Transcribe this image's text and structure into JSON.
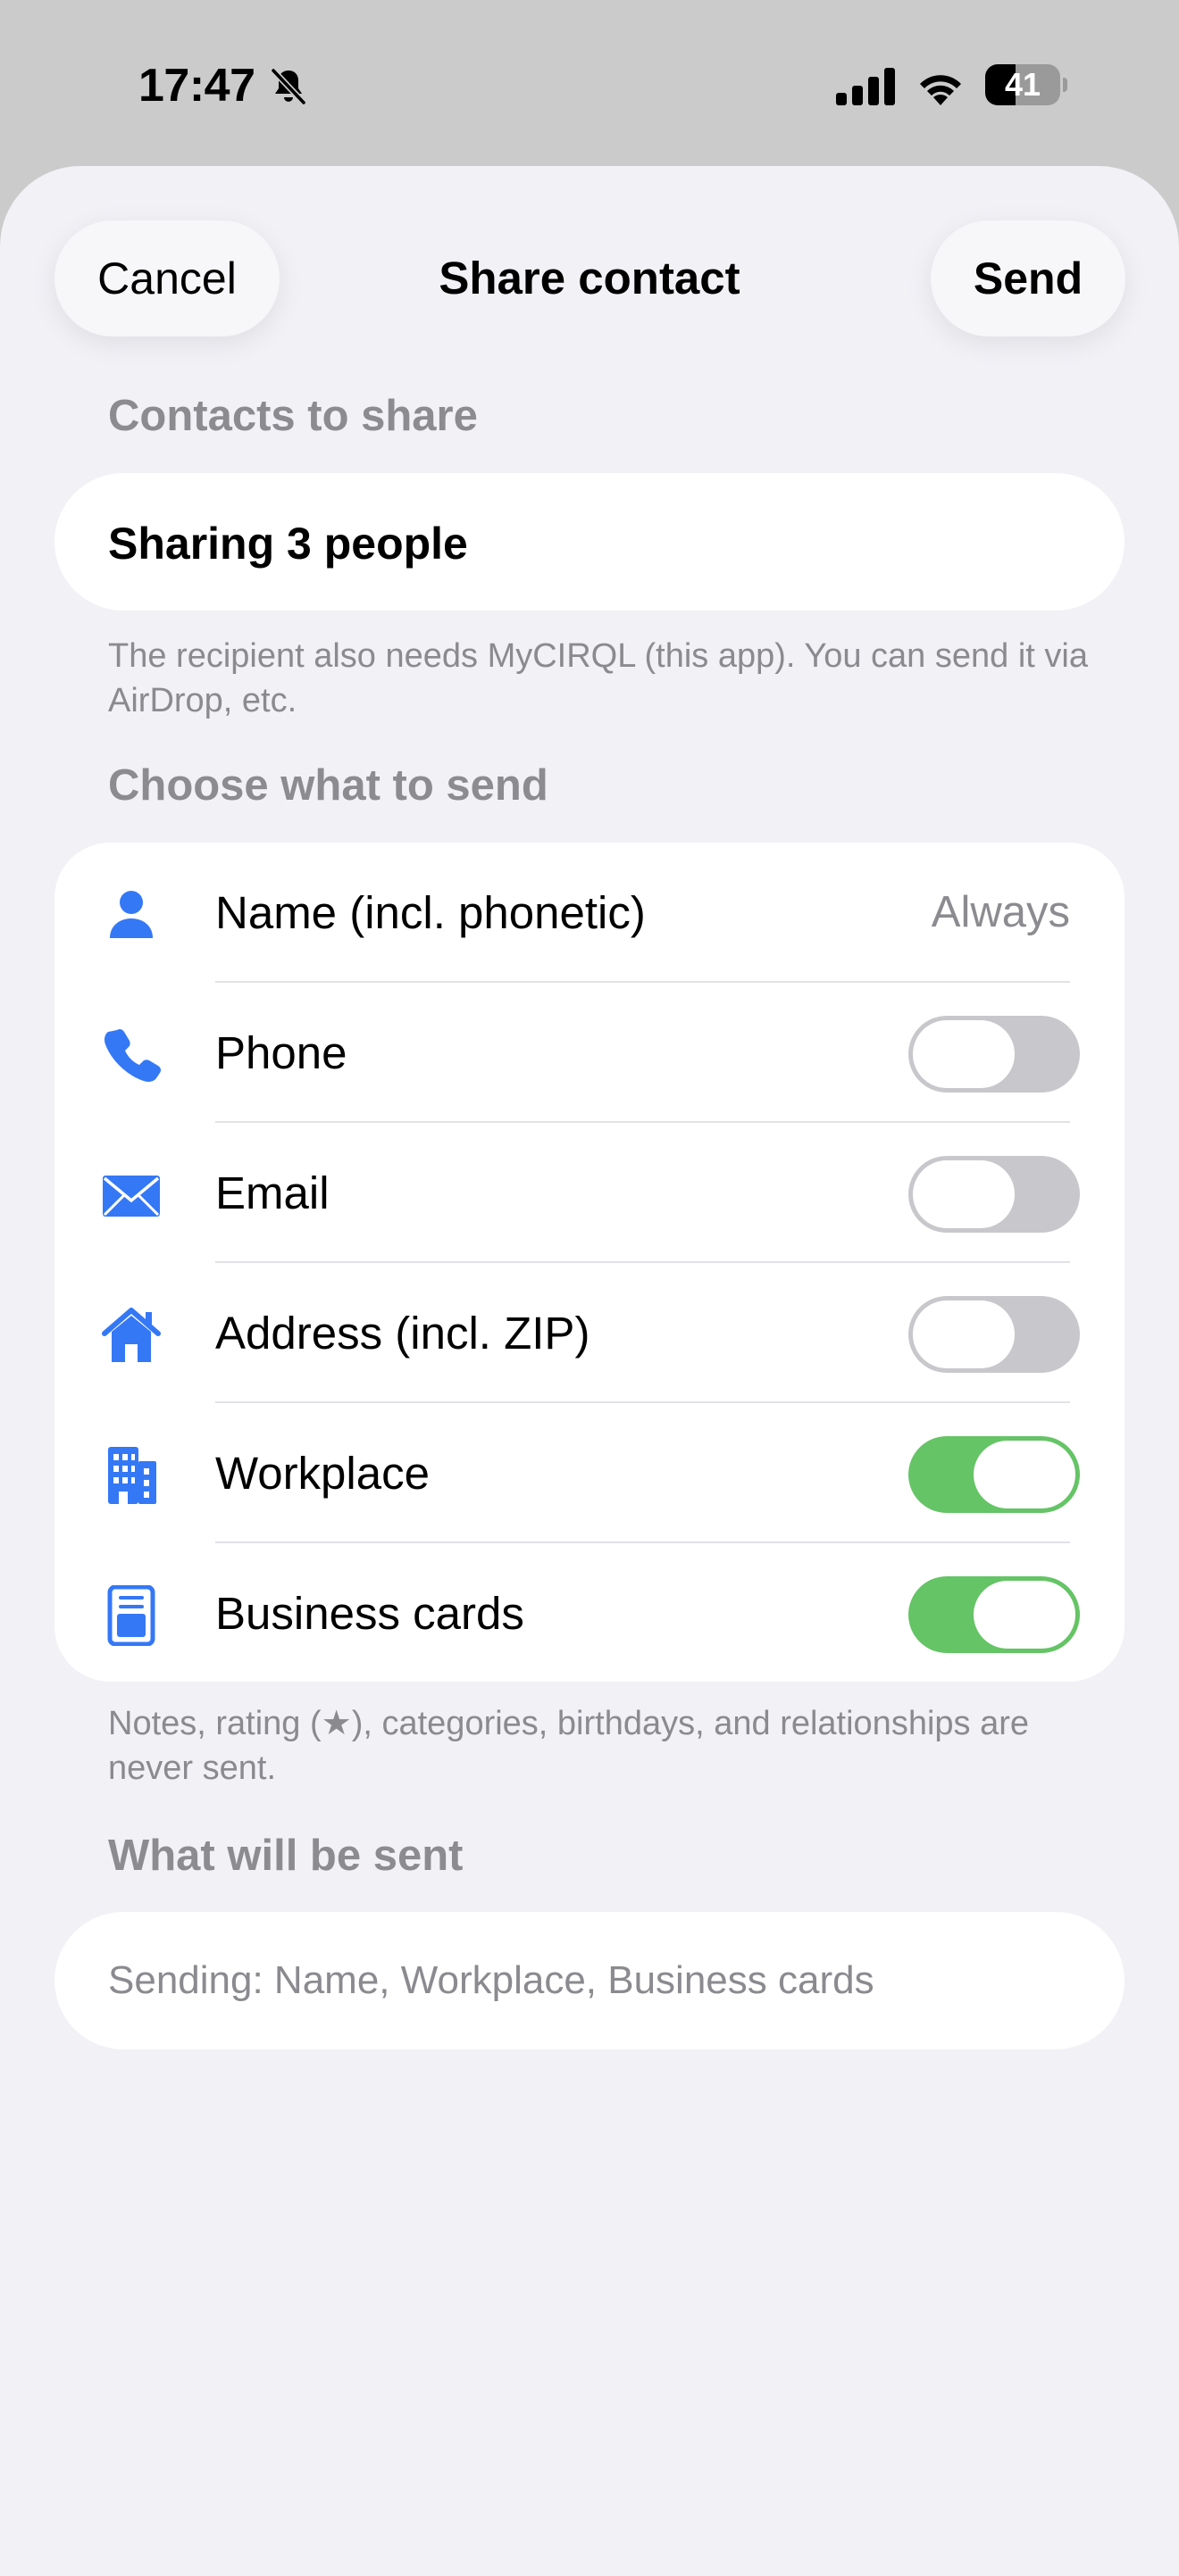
{
  "status_bar": {
    "time": "17:47",
    "battery_level": "41",
    "battery_fraction": 0.41,
    "icons": [
      "bell-slash-icon",
      "cellular-signal-icon",
      "wifi-icon",
      "battery-icon"
    ]
  },
  "nav": {
    "cancel_label": "Cancel",
    "title": "Share contact",
    "send_label": "Send"
  },
  "contacts_section": {
    "header": "Contacts to share",
    "sharing_label": "Sharing 3 people",
    "footnote": "The recipient also needs MyCIRQL (this app). You can send it via AirDrop, etc."
  },
  "options_section": {
    "header": "Choose what to send",
    "rows": [
      {
        "label": "Name (incl. phonetic)",
        "value": "Always",
        "icon": "person-icon"
      },
      {
        "label": "Phone",
        "enabled": false,
        "icon": "phone-icon"
      },
      {
        "label": "Email",
        "enabled": false,
        "icon": "envelope-icon"
      },
      {
        "label": "Address (incl. ZIP)",
        "enabled": false,
        "icon": "house-icon"
      },
      {
        "label": "Workplace",
        "enabled": true,
        "icon": "building-icon"
      },
      {
        "label": "Business cards",
        "enabled": true,
        "icon": "business-card-icon"
      }
    ],
    "footnote": "Notes, rating (★), categories, birthdays, and relationships are never sent."
  },
  "summary_section": {
    "header": "What will be sent",
    "summary": "Sending: Name, Workplace, Business cards"
  },
  "colors": {
    "accent": "#3478f6",
    "toggle_on": "#65c466",
    "toggle_off": "#c8c8cc",
    "sheet_bg": "#f1f1f6",
    "secondary_text": "#8b8b90"
  }
}
